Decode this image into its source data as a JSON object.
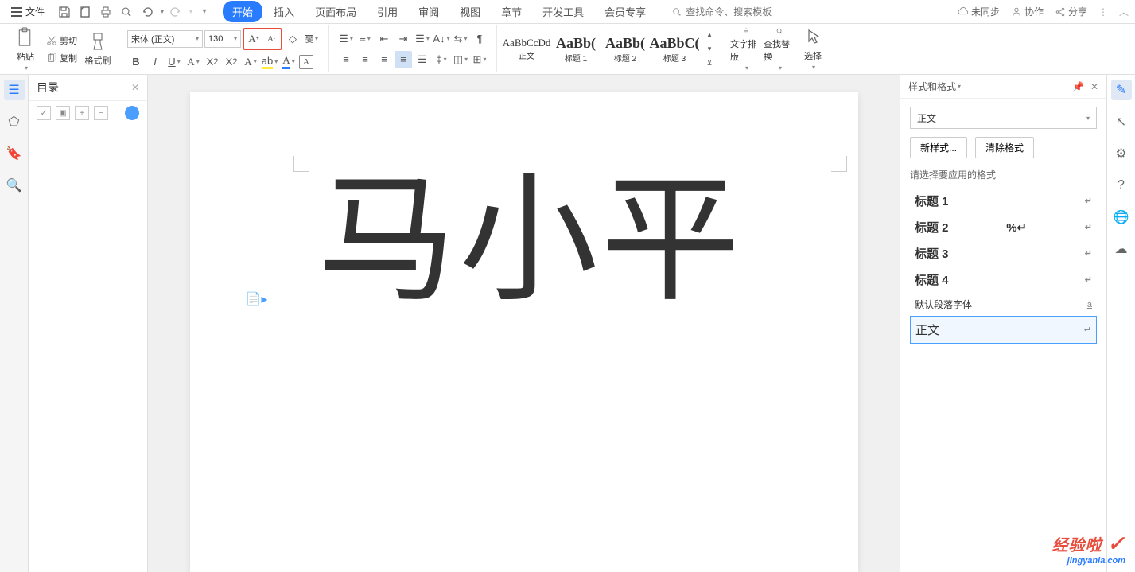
{
  "menubar": {
    "file": "文件",
    "tabs": [
      "开始",
      "插入",
      "页面布局",
      "引用",
      "审阅",
      "视图",
      "章节",
      "开发工具",
      "会员专享"
    ],
    "active_tab_index": 0,
    "search_placeholder": "查找命令、搜索模板",
    "sync": "未同步",
    "collab": "协作",
    "share": "分享"
  },
  "ribbon": {
    "paste": "粘贴",
    "cut": "剪切",
    "copy": "复制",
    "format_painter": "格式刷",
    "font_name": "宋体 (正文)",
    "font_size": "130",
    "style_preview": [
      "AaBbCcDd",
      "AaBb(",
      "AaBb(",
      "AaBbC("
    ],
    "style_labels": [
      "正文",
      "标题 1",
      "标题 2",
      "标题 3"
    ],
    "typesetting": "文字排版",
    "find_replace": "查找替换",
    "select": "选择"
  },
  "outline": {
    "title": "目录"
  },
  "document": {
    "text": "马小平"
  },
  "styles_panel": {
    "title": "样式和格式",
    "current": "正文",
    "new_style": "新样式...",
    "clear_format": "清除格式",
    "choose_label": "请选择要应用的格式",
    "items": [
      "标题 1",
      "标题 2",
      "标题 3",
      "标题 4"
    ],
    "default_font": "默认段落字体",
    "body_text": "正文"
  },
  "watermark": {
    "brand": "经验啦",
    "url": "jingyanla.com"
  }
}
